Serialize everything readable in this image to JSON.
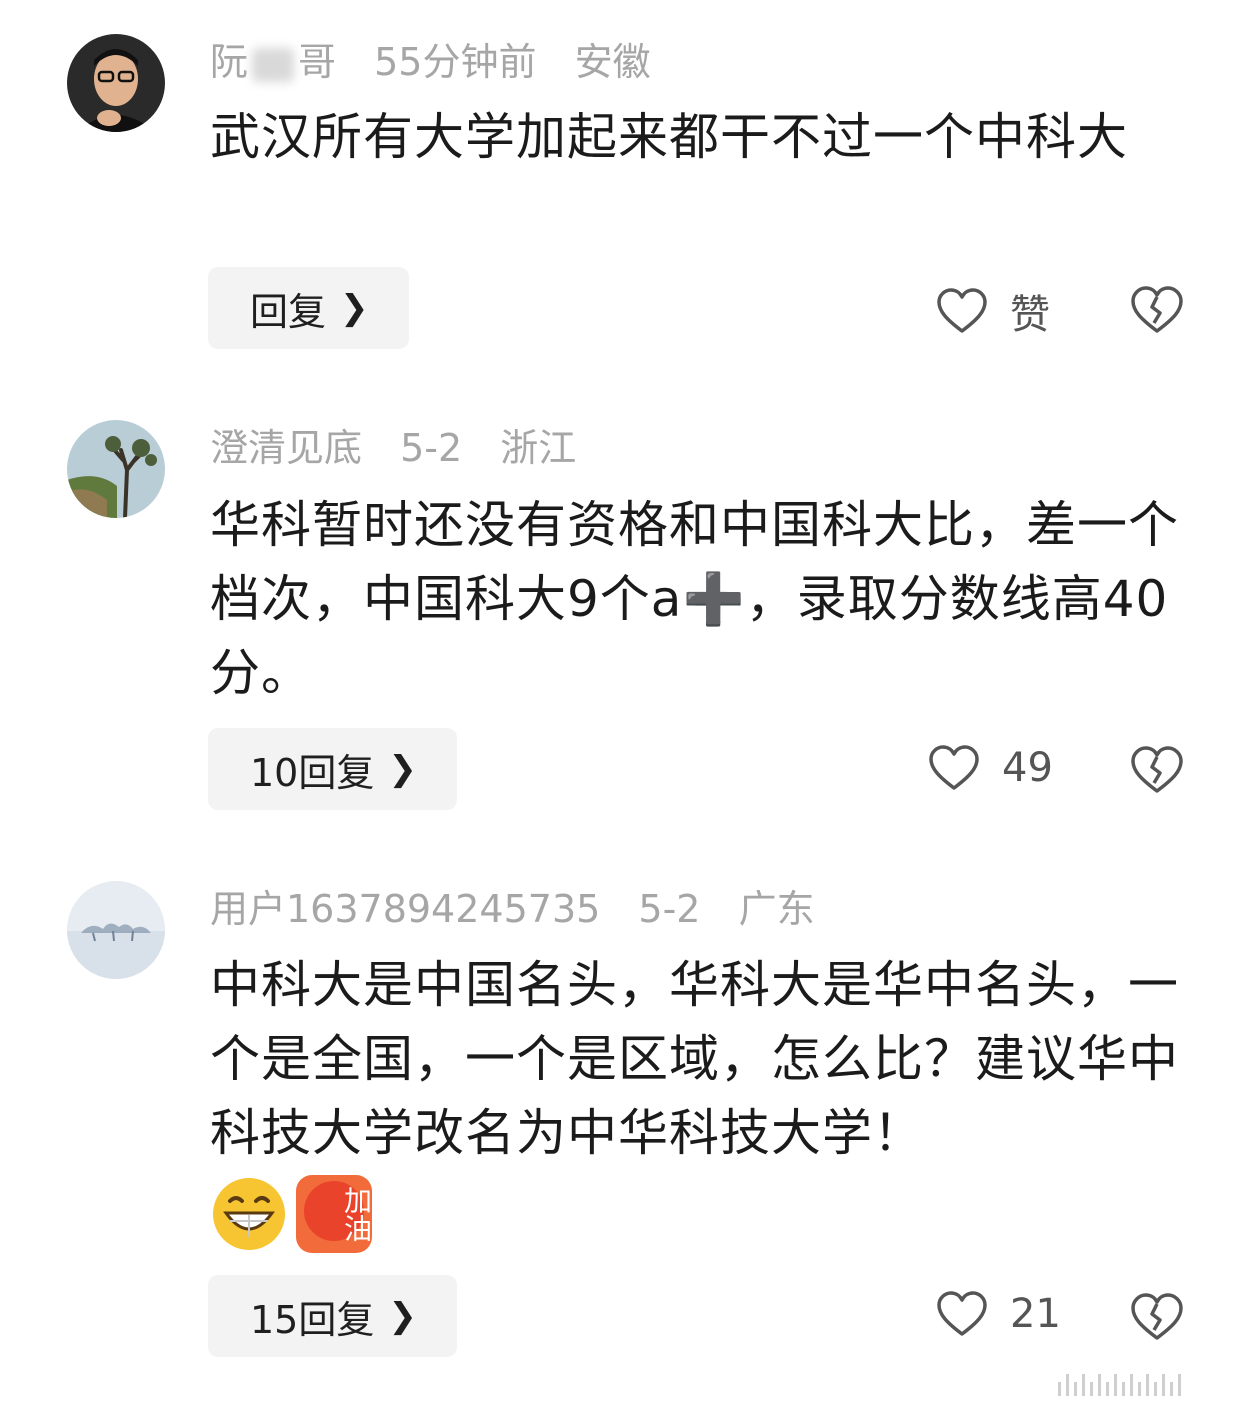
{
  "comments": [
    {
      "author": "阮哥",
      "author_visible_start": "阮",
      "author_visible_end": "哥",
      "time": "55分钟前",
      "location": "安徽",
      "text": "武汉所有大学加起来都干不过一个中科大",
      "reply_label": "回复",
      "likes": "赞"
    },
    {
      "author": "澄清见底",
      "time": "5-2",
      "location": "浙江",
      "text": "华科暂时还没有资格和中国科大比，差一个档次，中国科大9个a➕，录取分数线高40分。",
      "reply_label": "10回复",
      "likes": "49"
    },
    {
      "author": "用户1637894245735",
      "time": "5-2",
      "location": "广东",
      "text": "中科大是中国名头，华科大是华中名头，一个是全国，一个是区域，怎么比？建议华中科技大学改名为中华科技大学！",
      "emojis": [
        "grinning-emoji",
        "jiayou-emoji"
      ],
      "emoji_text": "加油",
      "reply_label": "15回复",
      "likes": "21"
    }
  ],
  "icons": {
    "like": "heart-outline-icon",
    "dislike": "broken-heart-icon",
    "chevron": "chevron-right-icon"
  },
  "colors": {
    "meta": "#a6a6a6",
    "button_bg": "#f3f3f3",
    "text": "#1b1b1b"
  }
}
